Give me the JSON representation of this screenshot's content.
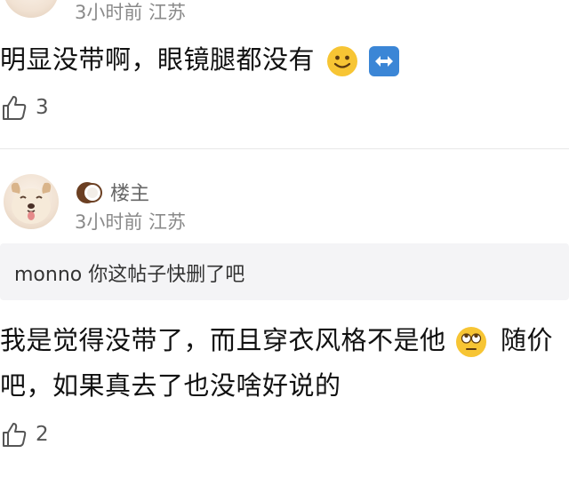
{
  "comment1": {
    "meta": "3小时前 江苏",
    "text": "明显没带啊，眼镜腿都没有",
    "likes": "3",
    "emoji_icons": [
      "slightly-smiling-face-icon",
      "left-right-arrow-icon"
    ]
  },
  "comment2": {
    "badge": "楼主",
    "meta": "3小时前 江苏",
    "quote": "monno 你这帖子快删了吧",
    "text_line1": "我是觉得没带了，而且穿衣风格不是他",
    "text_line1_end": "随价",
    "text_line2": "吧，如果真去了也没啥好说的",
    "likes": "2",
    "emoji_icons": [
      "face-with-rolling-eyes-icon"
    ]
  },
  "colors": {
    "background": "#ffffff",
    "meta_text": "#8a8a8a",
    "quote_background": "#f4f4f6",
    "emoji_yellow": "#f7c534",
    "arrow_blue": "#3b86d6"
  }
}
